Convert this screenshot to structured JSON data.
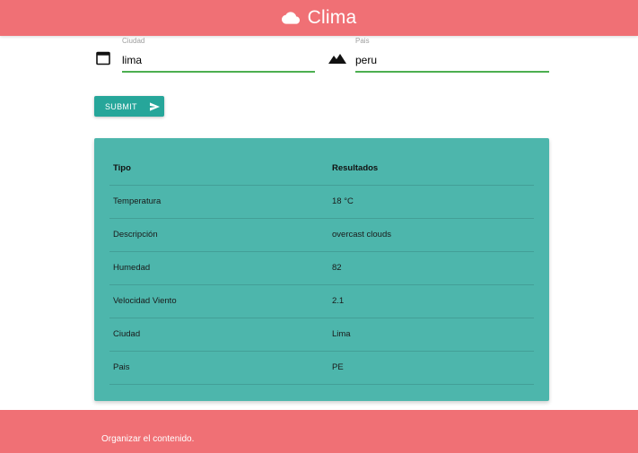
{
  "app": {
    "title": "Clima",
    "brand_icon": "cloud-icon",
    "accent": "#f07075",
    "primary": "#26a69a",
    "card_bg": "#4db6ac",
    "input_underline": "#4caf50"
  },
  "form": {
    "city": {
      "label": "Ciudad",
      "value": "lima",
      "icon": "calendar-icon"
    },
    "country": {
      "label": "Pais",
      "value": "peru",
      "icon": "landscape-icon"
    },
    "submit_label": "SUBMIT",
    "submit_icon": "send-icon"
  },
  "results": {
    "headers": [
      "Tipo",
      "Resultados"
    ],
    "rows": [
      [
        "Temperatura",
        "18 °C"
      ],
      [
        "Descripción",
        "overcast clouds"
      ],
      [
        "Humedad",
        "82"
      ],
      [
        "Velocidad Viento",
        "2.1"
      ],
      [
        "Ciudad",
        "Lima"
      ],
      [
        "Pais",
        "PE"
      ]
    ]
  },
  "footer": {
    "text": "Organizar el contenido."
  }
}
